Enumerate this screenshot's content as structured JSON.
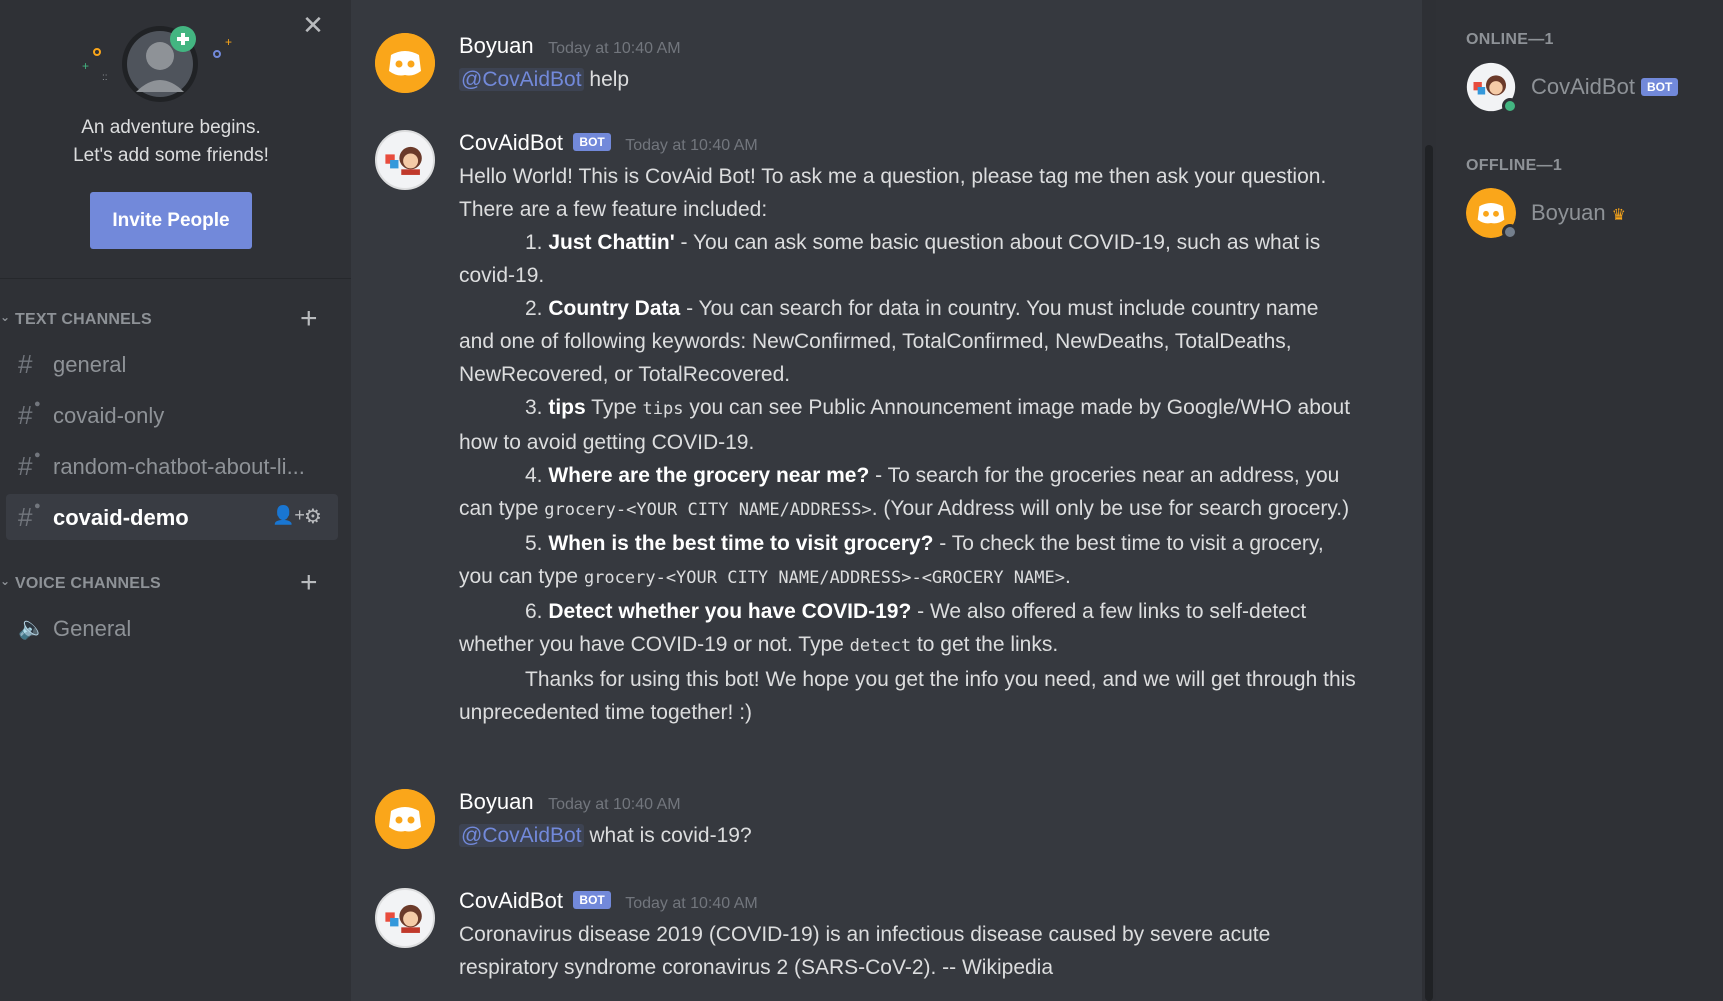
{
  "sidebar": {
    "welcome_line1": "An adventure begins.",
    "welcome_line2": "Let's add some friends!",
    "invite_label": "Invite People",
    "text_category": "TEXT CHANNELS",
    "voice_category": "VOICE CHANNELS",
    "text_channels": [
      "general",
      "covaid-only",
      "random-chatbot-about-li...",
      "covaid-demo"
    ],
    "active_channel": "covaid-demo",
    "voice_channels": [
      "General"
    ]
  },
  "messages": [
    {
      "author": "Boyuan",
      "timestamp": "Today at 10:40 AM",
      "mention": "@CovAidBot",
      "text": "help"
    },
    {
      "author": "CovAidBot",
      "bot_label": "BOT",
      "timestamp": "Today at 10:40 AM",
      "intro": "Hello World! This is CovAid Bot! To ask me a question, please tag me then ask your question. There are a few feature included:",
      "f1_title": "Just Chattin'",
      "f1_text": "- You can ask some basic question about COVID-19, such as what is covid-19.",
      "f2_title": "Country Data",
      "f2_text": "- You can search for data in country. You must include country name and one of following keywords: NewConfirmed, TotalConfirmed, NewDeaths, TotalDeaths, NewRecovered, or TotalRecovered.",
      "f3_title": "tips",
      "f3_pre": "Type",
      "f3_code": "tips",
      "f3_text": "you can see Public Announcement image made by Google/WHO about how to avoid getting COVID-19.",
      "f4_title": "Where are the grocery near me?",
      "f4_pre": "- To search for the groceries near an address, you can type",
      "f4_code": "grocery-<YOUR CITY NAME/ADDRESS>",
      "f4_text": ". (Your Address will only be use for search grocery.)",
      "f5_title": "When is the best time to visit grocery?",
      "f5_pre": "- To check the best time to visit a grocery, you can type",
      "f5_code": "grocery-<YOUR CITY NAME/ADDRESS>-<GROCERY NAME>",
      "f5_text": ".",
      "f6_title": "Detect whether you have COVID-19?",
      "f6_pre": "- We also offered a few links to self-detect whether you have COVID-19 or not. Type",
      "f6_code": "detect",
      "f6_text": "to get the links.",
      "outro": "Thanks for using this bot! We hope you get the info you need, and we will get through this unprecedented time together! :)"
    },
    {
      "author": "Boyuan",
      "timestamp": "Today at 10:40 AM",
      "mention": "@CovAidBot",
      "text": "what is covid-19?"
    },
    {
      "author": "CovAidBot",
      "bot_label": "BOT",
      "timestamp": "Today at 10:40 AM",
      "text": "Coronavirus disease 2019 (COVID-19) is an infectious disease caused by severe acute respiratory syndrome coronavirus 2 (SARS-CoV-2). -- Wikipedia"
    }
  ],
  "members": {
    "online_header": "ONLINE—1",
    "offline_header": "OFFLINE—1",
    "online": [
      {
        "name": "CovAidBot",
        "bot_label": "BOT",
        "status": "online"
      }
    ],
    "offline": [
      {
        "name": "Boyuan",
        "status": "offline",
        "owner": true
      }
    ]
  },
  "colors": {
    "accent": "#7289da",
    "online": "#43b581",
    "boyuan_avatar": "#faa61a",
    "crown": "#faa61a"
  },
  "icons": [
    "close-icon",
    "add-friend-icon",
    "plus-icon",
    "hash-icon",
    "add-member-icon",
    "gear-icon",
    "speaker-icon",
    "crown-icon",
    "discord-avatar-icon"
  ]
}
